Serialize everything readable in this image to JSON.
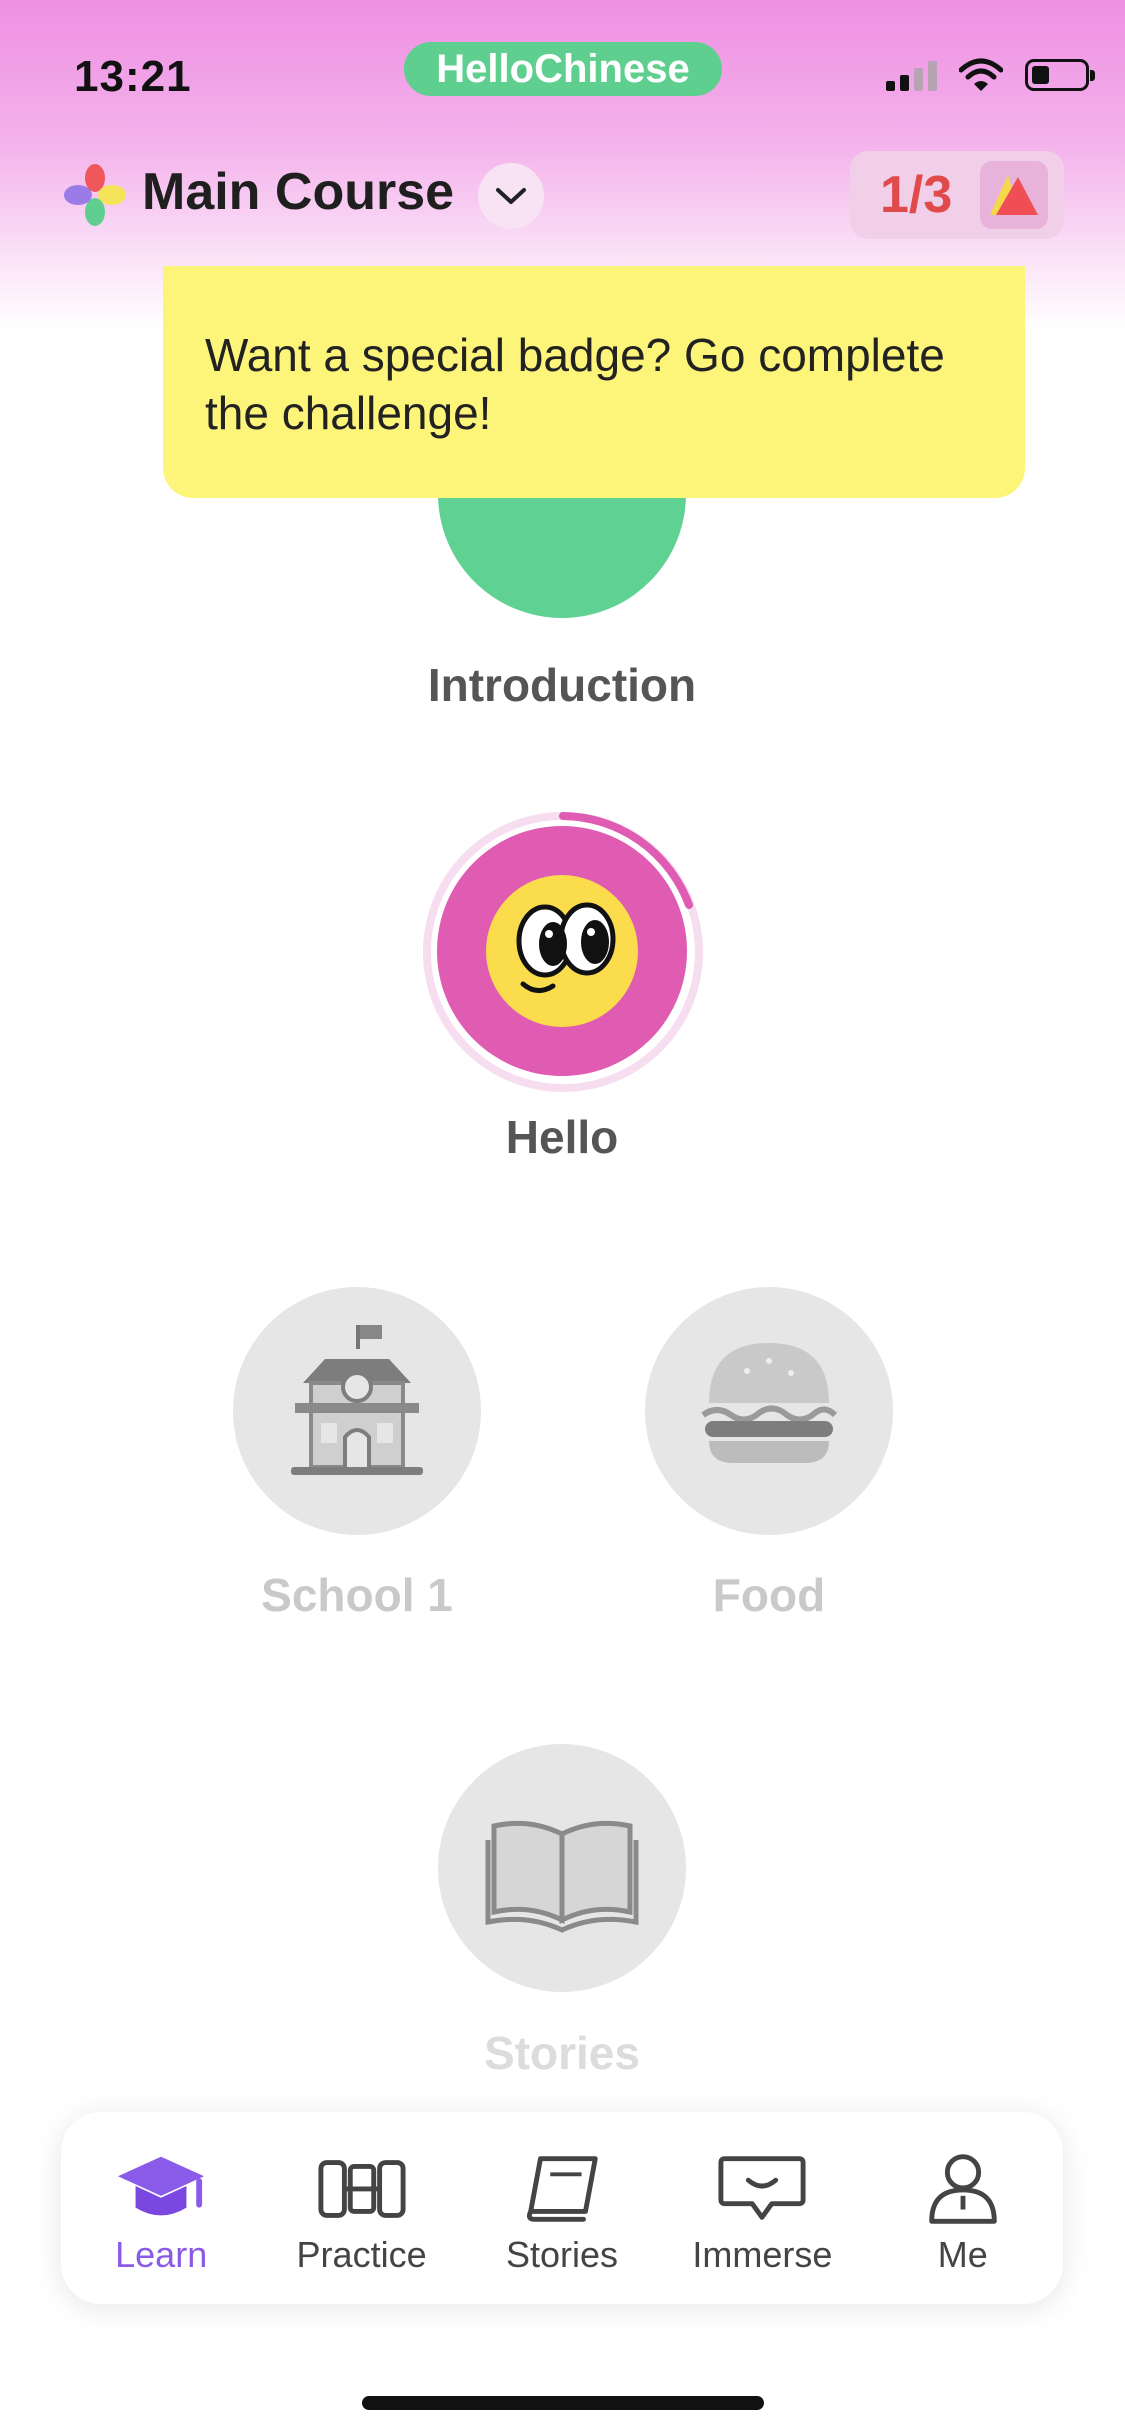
{
  "status_bar": {
    "time": "13:21",
    "app_name": "HelloChinese"
  },
  "header": {
    "course_title": "Main Course",
    "progress": "1/3"
  },
  "tooltip": {
    "text": "Want a special badge? Go complete the challenge!"
  },
  "lessons": [
    {
      "label": "Introduction",
      "state": "completed",
      "icon": "pencil-icon"
    },
    {
      "label": "Hello",
      "state": "in-progress",
      "icon": "smiley-face-icon"
    },
    {
      "label": "School 1",
      "state": "locked",
      "icon": "school-building-icon"
    },
    {
      "label": "Food",
      "state": "locked",
      "icon": "burger-icon"
    },
    {
      "label": "Stories",
      "state": "locked",
      "icon": "open-book-icon"
    }
  ],
  "nav": {
    "items": [
      {
        "label": "Learn",
        "icon": "graduation-cap-icon",
        "active": true
      },
      {
        "label": "Practice",
        "icon": "dumbbell-icon",
        "active": false
      },
      {
        "label": "Stories",
        "icon": "book-icon",
        "active": false
      },
      {
        "label": "Immerse",
        "icon": "chat-bubble-icon",
        "active": false
      },
      {
        "label": "Me",
        "icon": "person-icon",
        "active": false
      }
    ]
  },
  "colors": {
    "header_gradient": "#ee8fe2",
    "app_pill": "#5ecf8f",
    "tooltip": "#fdf57a",
    "progress_text": "#e04a4a",
    "active_nav": "#8a5be8",
    "intro_circle": "#5fd293",
    "hello_circle": "#df5cb2",
    "locked_circle": "#e6e6e6"
  }
}
